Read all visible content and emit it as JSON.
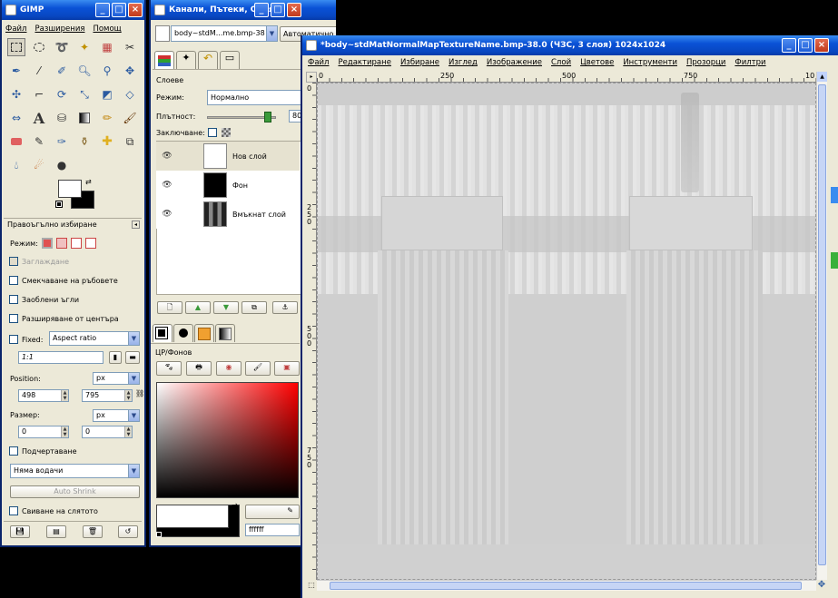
{
  "toolbox": {
    "title": "GIMP",
    "menu": [
      "Файл",
      "Разширения",
      "Помощ"
    ],
    "tool_options_title": "Правоъгълно избиране",
    "mode_label": "Режим:",
    "antialias_label": "Заглаждане",
    "feather_label": "Смекчаване на ръбовете",
    "rounded_label": "Заоблени ъгли",
    "expand_label": "Разширяване от центъра",
    "fixed_label": "Fixed:",
    "fixed_value": "Aspect ratio",
    "ratio_value": "1:1",
    "position_label": "Position:",
    "position_unit": "px",
    "position_x": "498",
    "position_y": "795",
    "size_label": "Размер:",
    "size_unit": "px",
    "size_w": "0",
    "size_h": "0",
    "highlight_label": "Подчертаване",
    "guides_value": "Няма водачи",
    "auto_shrink_label": "Auto Shrink",
    "shrink_merged_label": "Свиване на слятото"
  },
  "layers": {
    "title": "Канали, Пътеки, Отмя...",
    "image_selector": "body~stdM...me.bmp-38",
    "auto_button": "Автоматично",
    "section_title": "Слоеве",
    "mode_label": "Режим:",
    "mode_value": "Нормално",
    "opacity_label": "Плътност:",
    "opacity_value": "80",
    "lock_label": "Заключване:",
    "items": [
      {
        "name": "Нов слой",
        "thumb": "#ffffff"
      },
      {
        "name": "Фон",
        "thumb": "#000000"
      },
      {
        "name": "Вмъкнат слой",
        "thumb": "#555555"
      }
    ],
    "fgbg_title": "ЦР/Фонов",
    "hex_value": "ffffff"
  },
  "image_window": {
    "title": "*body~stdMatNormalMapTextureName.bmp-38.0 (ЧЗС, 3 слоя) 1024x1024",
    "menu": [
      "Файл",
      "Редактиране",
      "Избиране",
      "Изглед",
      "Изображение",
      "Слой",
      "Цветове",
      "Инструменти",
      "Прозорци",
      "Филтри"
    ],
    "hruler": [
      "0",
      "250",
      "500",
      "750",
      "10"
    ],
    "vruler": [
      "0",
      "2 5 0",
      "5 0 0",
      "7 5 0"
    ]
  },
  "colors": {
    "xp_blue": "#0a52d6",
    "window_bg": "#ece9d8",
    "canvas_gray": "#cfcfcf"
  }
}
